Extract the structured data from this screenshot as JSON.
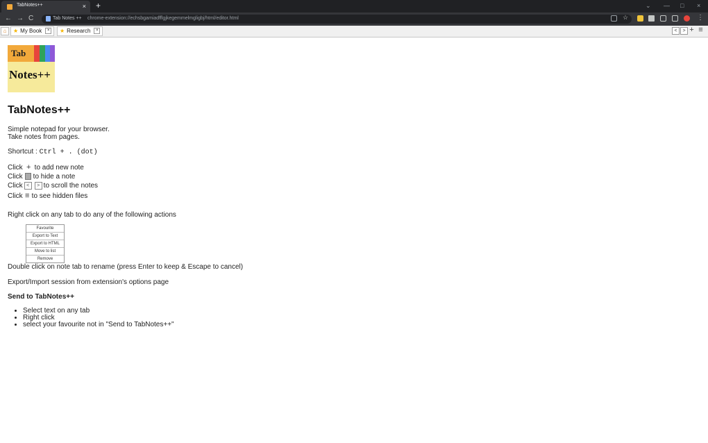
{
  "browser": {
    "tab_title": "TabNotes++",
    "tab_close": "×",
    "new_tab": "+",
    "window_controls": [
      "⌄",
      "—",
      "□",
      "×"
    ],
    "nav": {
      "back": "←",
      "forward": "→",
      "reload": "C"
    },
    "omnibox": {
      "extension_label": "Tab Notes ++",
      "url": "chrome-extension://echsbgamiadfflgjkegemmelmgligbj/html/editor.html"
    },
    "toolbar_icons": [
      "share-icon",
      "star-icon",
      "folder-icon",
      "extensions-icon",
      "reading-list-icon",
      "side-panel-icon",
      "profile-icon",
      "menu-icon"
    ],
    "colors": {
      "frame": "#202124",
      "toolbar": "#35363a",
      "accent": "#f2a93b"
    }
  },
  "notebar": {
    "home_icon": "⌂",
    "tabs": [
      {
        "label": "My Book",
        "icon": "★"
      },
      {
        "label": "Research",
        "icon": "★"
      }
    ],
    "scroll_left": "<",
    "scroll_right": ">",
    "add": "+",
    "hidden_menu": "≡"
  },
  "logo": {
    "top_text": "Tab",
    "bottom_text": "Notes++",
    "stripe_colors": [
      "#f2a93b",
      "#e8453c",
      "#2fa35b",
      "#4a8af4",
      "#8e59d8"
    ]
  },
  "content": {
    "title": "TabNotes++",
    "intro1": "Simple notepad for your browser.",
    "intro2": "Take notes from pages.",
    "shortcut_prefix": "Shortcut : ",
    "shortcut_keys": "Ctrl + . (dot)",
    "click_add_pre": "Click",
    "click_add_post": "to add new note",
    "click_hide_pre": "Click",
    "click_hide_post": "to hide a note",
    "click_scroll_pre": "Click",
    "click_scroll_post": "to scroll the notes",
    "click_hidden_pre": "Click",
    "click_hidden_post": "to see hidden files",
    "right_click": "Right click on any tab to do any of the following actions",
    "menu_items": [
      "Favourite",
      "Export to Text",
      "Export to HTML",
      "Move to list",
      "Remove"
    ],
    "double_click": "Double click on note tab to rename (press Enter to keep & Escape to cancel)",
    "export_import": "Export/Import session from extension's options page",
    "send_title": "Send to TabNotes++",
    "send_steps": [
      "Select text on any tab",
      "Right click",
      "select your favourite not in \"Send to TabNotes++\""
    ]
  }
}
